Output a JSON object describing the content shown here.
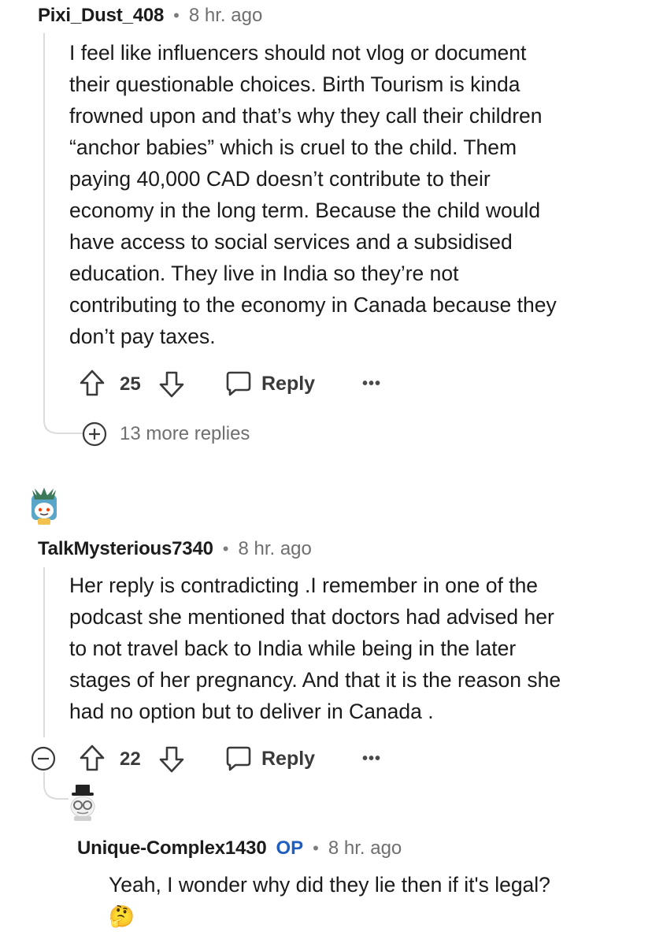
{
  "comments": [
    {
      "username": "Pixi_Dust_408",
      "separator": "•",
      "time": "8 hr. ago",
      "lines": [
        "I feel like influencers should not vlog or document",
        "their questionable choices. Birth Tourism is kinda",
        "frowned upon and that’s why they call their children",
        "“anchor babies” which is cruel to the child. Them",
        "paying 40,000 CAD doesn’t contribute to their",
        "economy in the long term. Because the child would",
        "have access to social services and a subsidised",
        "education. They live in India so they’re not",
        "contributing to the economy in Canada because they",
        "don’t pay taxes."
      ],
      "score": "25",
      "reply_label": "Reply",
      "more_label": "•••",
      "more_replies": "13 more replies"
    },
    {
      "username": "TalkMysterious7340",
      "separator": "•",
      "time": "8 hr. ago",
      "lines": [
        "Her reply is contradicting .I remember in one of the",
        "podcast she mentioned that doctors had advised her",
        "to not travel back to India while being in the later",
        "stages of her pregnancy. And that it is the reason she",
        "had no option but to deliver in Canada ."
      ],
      "score": "22",
      "reply_label": "Reply",
      "more_label": "•••"
    },
    {
      "username": "Unique-Complex1430",
      "op_badge": "OP",
      "separator": "•",
      "time": "8 hr. ago",
      "lines": [
        "Yeah, I wonder why did they lie then if it's legal?"
      ],
      "emoji": "🤔"
    }
  ],
  "colors": {
    "op_badge": "#1f5fbf",
    "thread_line": "#dcdcdc",
    "meta_text": "#6f6f6f"
  },
  "icons": [
    "upvote-arrow-icon",
    "downvote-arrow-icon",
    "speech-bubble-icon",
    "plus-circle-icon",
    "minus-circle-icon",
    "overflow-dots-icon",
    "avatar-snoo"
  ]
}
